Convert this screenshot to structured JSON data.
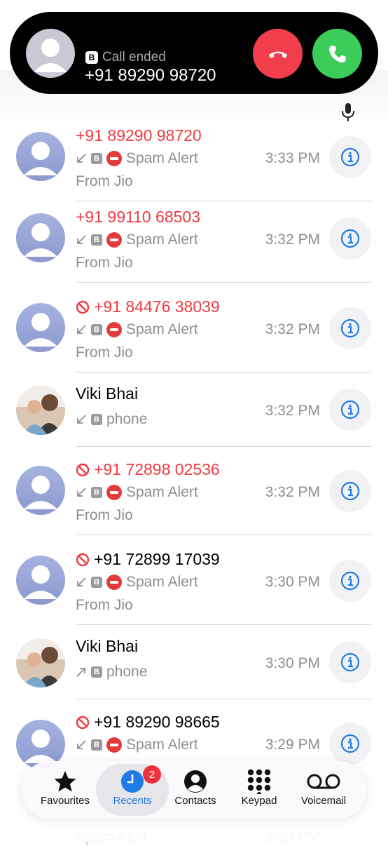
{
  "banner": {
    "status_badge": "B",
    "status_text": "Call ended",
    "number": "+91 89290 98720"
  },
  "calls": [
    {
      "name": "+91 89290 98720",
      "blocked": false,
      "red": true,
      "line": "B",
      "label": "Spam Alert",
      "sub": "From Jio",
      "time": "3:33 PM",
      "dir": "in"
    },
    {
      "name": "+91 99110 68503",
      "blocked": false,
      "red": true,
      "line": "B",
      "label": "Spam Alert",
      "sub": "From Jio",
      "time": "3:32 PM",
      "dir": "in"
    },
    {
      "name": "+91 84476 38039",
      "blocked": true,
      "red": true,
      "line": "B",
      "label": "Spam Alert",
      "sub": "From Jio",
      "time": "3:32 PM",
      "dir": "in"
    },
    {
      "name": "Viki Bhai",
      "blocked": false,
      "red": false,
      "line": "B",
      "label": "phone",
      "sub": "",
      "time": "3:32 PM",
      "dir": "in",
      "photo": true
    },
    {
      "name": "+91 72898 02536",
      "blocked": true,
      "red": true,
      "line": "B",
      "label": "Spam Alert",
      "sub": "From Jio",
      "time": "3:32 PM",
      "dir": "in"
    },
    {
      "name": "+91 72899 17039",
      "blocked": true,
      "red": false,
      "line": "B",
      "label": "Spam Alert",
      "sub": "From Jio",
      "time": "3:30 PM",
      "dir": "in"
    },
    {
      "name": "Viki Bhai",
      "blocked": false,
      "red": false,
      "line": "B",
      "label": "phone",
      "sub": "",
      "time": "3:30 PM",
      "dir": "out",
      "photo": true
    },
    {
      "name": "+91 89290 98665",
      "blocked": true,
      "red": false,
      "line": "B",
      "label": "Spam Alert",
      "sub": "",
      "time": "3:29 PM",
      "dir": "in"
    }
  ],
  "tabs": [
    {
      "label": "Favourites",
      "icon": "star-icon"
    },
    {
      "label": "Recents",
      "icon": "clock-icon",
      "badge": "2"
    },
    {
      "label": "Contacts",
      "icon": "person-circle-icon"
    },
    {
      "label": "Keypad",
      "icon": "keypad-icon"
    },
    {
      "label": "Voicemail",
      "icon": "voicemail-icon"
    }
  ],
  "peek": {
    "label": "Spam Alert",
    "time": "3:29 PM"
  },
  "colors": {
    "missed": "#ef3b3f",
    "accent": "#1f7be6",
    "decline": "#f13d4c",
    "accept": "#3bcc5a"
  }
}
